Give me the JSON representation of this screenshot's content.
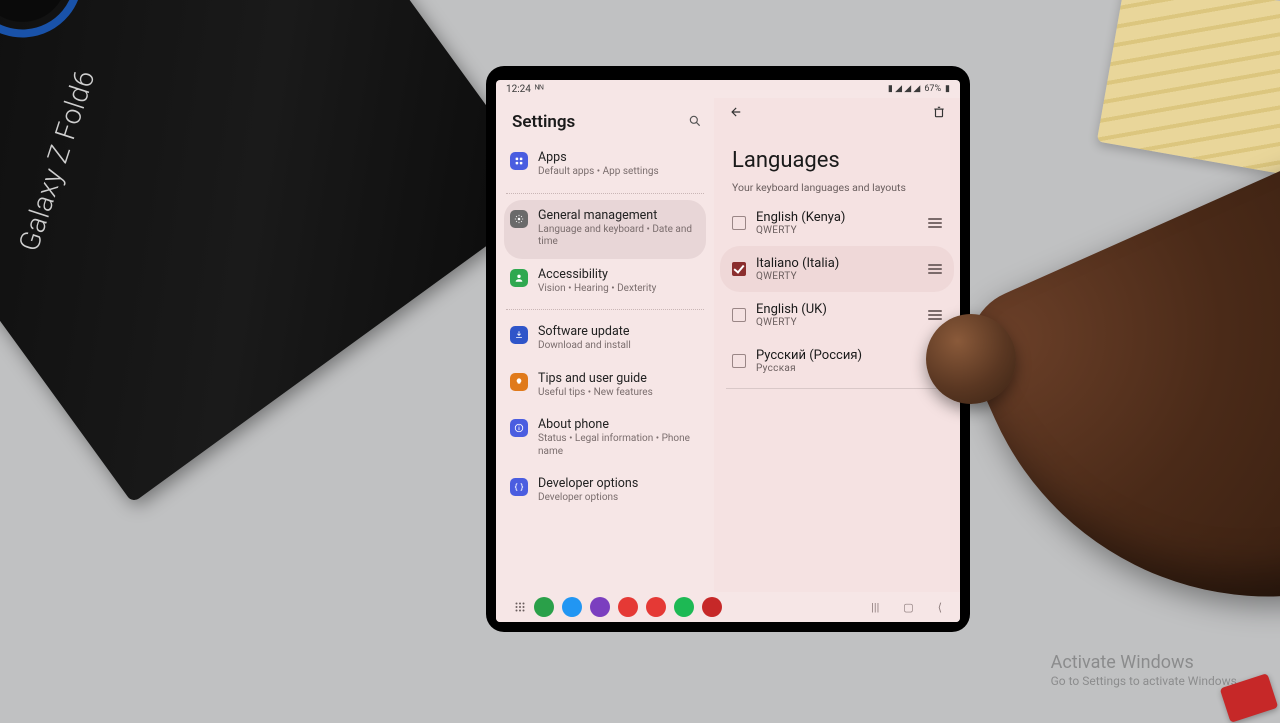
{
  "status": {
    "time": "12:24",
    "battery": "67%"
  },
  "left": {
    "title": "Settings",
    "items": [
      {
        "title": "Apps",
        "sub": "Default apps  •  App settings",
        "color": "#4a5de0",
        "icon": "grid",
        "selected": false
      },
      {
        "title": "General management",
        "sub": "Language and keyboard  •  Date and time",
        "color": "#6a6a6a",
        "icon": "gear",
        "selected": true
      },
      {
        "title": "Accessibility",
        "sub": "Vision  •  Hearing  •  Dexterity",
        "color": "#2fa84f",
        "icon": "person",
        "selected": false
      },
      {
        "title": "Software update",
        "sub": "Download and install",
        "color": "#2f55c9",
        "icon": "download",
        "selected": false
      },
      {
        "title": "Tips and user guide",
        "sub": "Useful tips  •  New features",
        "color": "#e07a1b",
        "icon": "bulb",
        "selected": false
      },
      {
        "title": "About phone",
        "sub": "Status  •  Legal information  •  Phone name",
        "color": "#4a5de0",
        "icon": "info",
        "selected": false
      },
      {
        "title": "Developer options",
        "sub": "Developer options",
        "color": "#4a5de0",
        "icon": "braces",
        "selected": false
      }
    ]
  },
  "right": {
    "title": "Languages",
    "subtitle": "Your keyboard languages and layouts",
    "langs": [
      {
        "name": "English (Kenya)",
        "layout": "QWERTY",
        "checked": false,
        "highlight": false
      },
      {
        "name": "Italiano (Italia)",
        "layout": "QWERTY",
        "checked": true,
        "highlight": true
      },
      {
        "name": "English (UK)",
        "layout": "QWERTY",
        "checked": false,
        "highlight": false
      },
      {
        "name": "Русский (Россия)",
        "layout": "Русская",
        "checked": false,
        "highlight": false
      }
    ]
  },
  "dock": {
    "apps": [
      {
        "name": "phone",
        "color": "#2aa049"
      },
      {
        "name": "messages",
        "color": "#2196f3"
      },
      {
        "name": "viber",
        "color": "#7b3fbf"
      },
      {
        "name": "app-red",
        "color": "#e53935"
      },
      {
        "name": "youtube",
        "color": "#e53935"
      },
      {
        "name": "spotify",
        "color": "#1db954"
      },
      {
        "name": "pdf",
        "color": "#c62828"
      }
    ]
  },
  "watermark": {
    "line1": "Activate Windows",
    "line2": "Go to Settings to activate Windows."
  },
  "box": {
    "label": "Galaxy Z Fold6"
  }
}
